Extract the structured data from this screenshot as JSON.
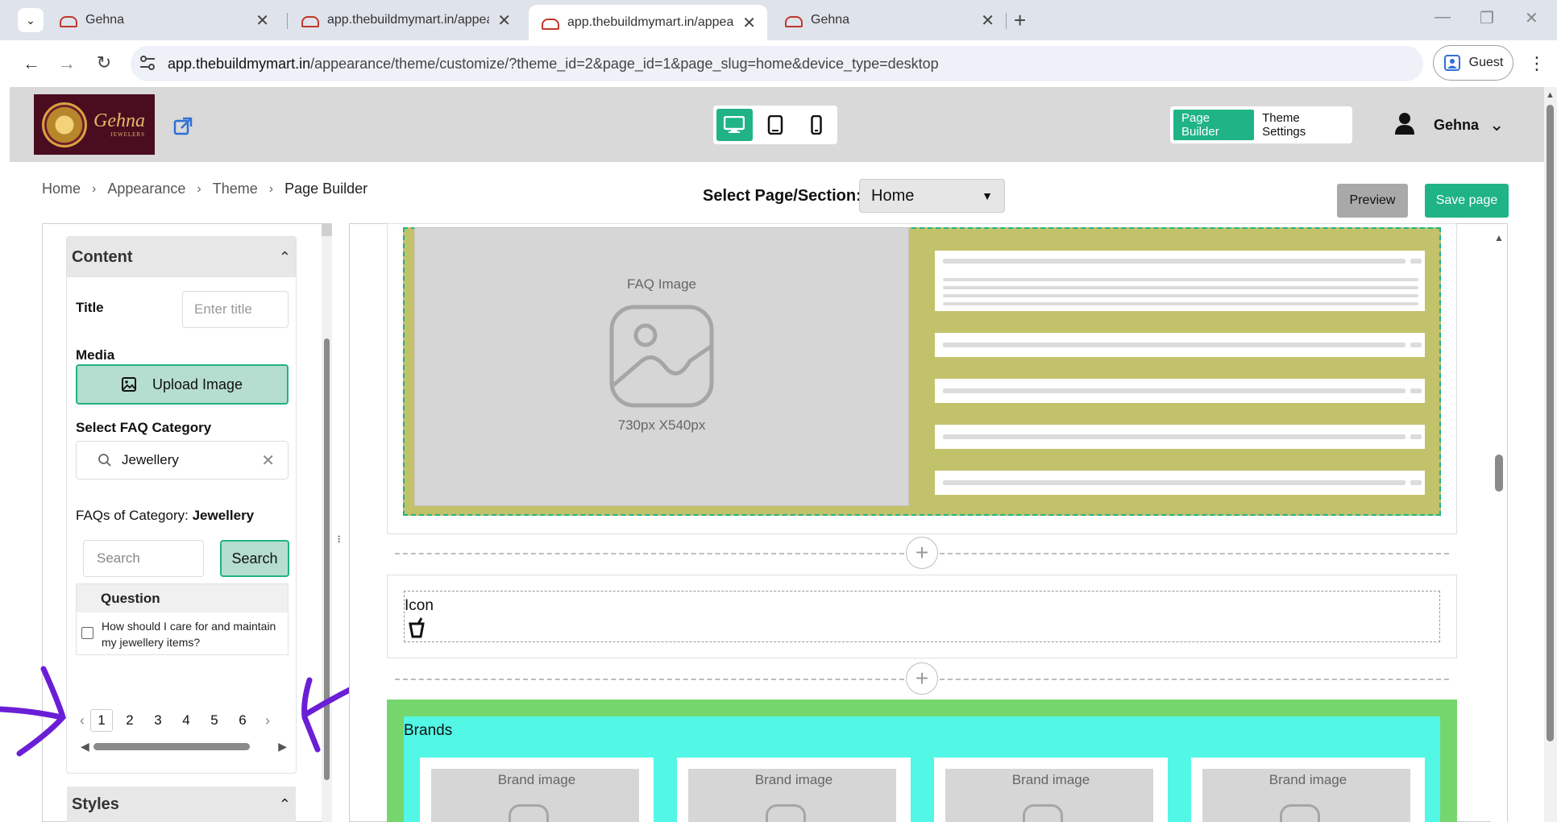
{
  "browser": {
    "tabs": [
      {
        "title": "Gehna",
        "active": false
      },
      {
        "title": "app.thebuildmymart.in/appeara",
        "active": false
      },
      {
        "title": "app.thebuildmymart.in/appeara",
        "active": true
      },
      {
        "title": "Gehna",
        "active": false
      }
    ],
    "url_host": "app.thebuildmymart.in",
    "url_path": "/appearance/theme/customize/?theme_id=2&page_id=1&page_slug=home&device_type=desktop",
    "profile_label": "Guest"
  },
  "header": {
    "logo_text": "Gehna",
    "logo_subtext": "JEWELERS",
    "page_builder_label": "Page Builder",
    "theme_settings_label": "Theme Settings",
    "user_name": "Gehna",
    "accent_color": "#1fb386"
  },
  "subheader": {
    "breadcrumbs": [
      "Home",
      "Appearance",
      "Theme",
      "Page Builder"
    ],
    "select_label": "Select Page/Section:",
    "select_value": "Home",
    "preview_label": "Preview",
    "save_label": "Save page"
  },
  "sidebar": {
    "content_title": "Content",
    "title_label": "Title",
    "title_placeholder": "Enter title",
    "media_label": "Media",
    "upload_label": "Upload Image",
    "category_label": "Select FAQ Category",
    "category_value": "Jewellery",
    "faqs_of_category_label": "FAQs of Category:",
    "faqs_of_category_value": "Jewellery",
    "search_placeholder": "Search",
    "search_button": "Search",
    "table_header": "Question",
    "questions": [
      "How should I care for and maintain my jewellery items?"
    ],
    "pages": [
      "1",
      "2",
      "3",
      "4",
      "5",
      "6"
    ],
    "current_page": "1",
    "styles_title": "Styles"
  },
  "canvas": {
    "faq_image_title": "FAQ Image",
    "faq_image_size": "730px X540px",
    "icon_section_label": "Icon",
    "brands_title": "Brands",
    "brand_cards": [
      "Brand image",
      "Brand image",
      "Brand image",
      "Brand image"
    ]
  }
}
